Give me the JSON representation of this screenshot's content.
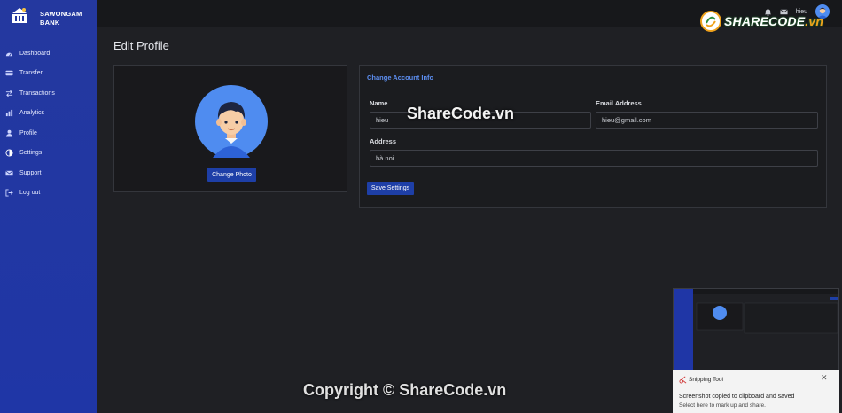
{
  "brand": {
    "name_line1": "SAWONGAM",
    "name_line2": "BANK"
  },
  "sidebar": {
    "items": [
      {
        "label": "Dashboard",
        "icon": "gauge-icon"
      },
      {
        "label": "Transfer",
        "icon": "card-icon"
      },
      {
        "label": "Transactions",
        "icon": "arrows-icon"
      },
      {
        "label": "Analytics",
        "icon": "chart-icon"
      },
      {
        "label": "Profile",
        "icon": "user-icon"
      },
      {
        "label": "Settings",
        "icon": "contrast-icon"
      },
      {
        "label": "Support",
        "icon": "mail-icon"
      },
      {
        "label": "Log out",
        "icon": "logout-icon"
      }
    ]
  },
  "topbar": {
    "username": "hieu"
  },
  "watermark": {
    "logo_text": "SHARECODE",
    "logo_suffix": ".vn",
    "overlay": "ShareCode.vn",
    "copyright": "Copyright © ShareCode.vn"
  },
  "page": {
    "title": "Edit Profile"
  },
  "photo_card": {
    "button": "Change Photo"
  },
  "account_card": {
    "heading": "Change Account Info",
    "name_label": "Name",
    "name_value": "hieu",
    "email_label": "Email Address",
    "email_value": "hieu@gmail.com",
    "address_label": "Address",
    "address_value": "hà noi",
    "save_button": "Save Settings"
  },
  "notification": {
    "app_name": "Snipping Tool",
    "message": "Screenshot copied to clipboard and saved",
    "sub": "Select here to mark up and share.",
    "more": "···",
    "close": "✕"
  },
  "colors": {
    "sidebar": "#1f36a6",
    "accent": "#5d8ff2",
    "button": "#1e3fa7",
    "background": "#1f2024"
  }
}
